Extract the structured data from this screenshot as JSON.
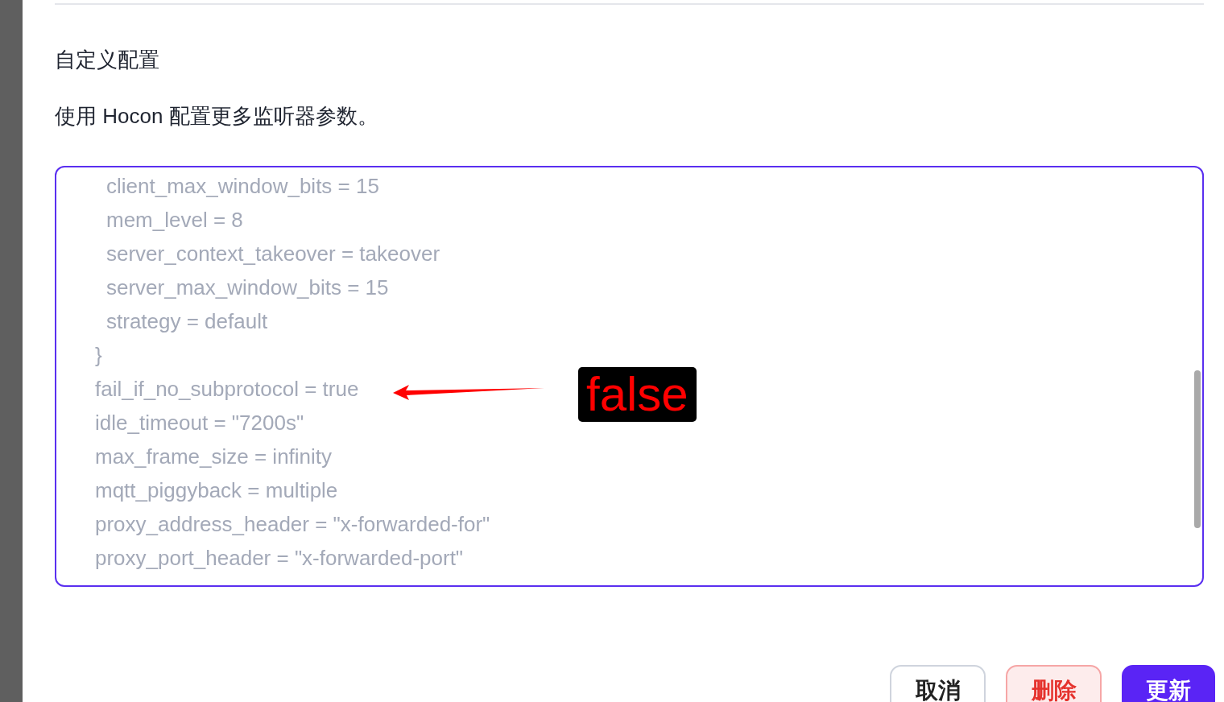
{
  "section": {
    "title": "自定义配置",
    "description": "使用 Hocon 配置更多监听器参数。"
  },
  "config_editor": {
    "lines": [
      {
        "children": [
          {
            "text": "client_max_window_bits = 15"
          },
          {
            "text": "mem_level = 8"
          },
          {
            "text": "server_context_takeover = takeover"
          },
          {
            "text": "server_max_window_bits = 15"
          },
          {
            "text": "strategy = default"
          }
        ]
      },
      {
        "text": "}"
      },
      {
        "text": "fail_if_no_subprotocol = true"
      },
      {
        "text": "idle_timeout = \"7200s\""
      },
      {
        "text": "max_frame_size = infinity"
      },
      {
        "text": "mqtt_piggyback = multiple"
      },
      {
        "text": "proxy_address_header = \"x-forwarded-for\""
      },
      {
        "text": "proxy_port_header = \"x-forwarded-port\""
      }
    ]
  },
  "annotation": {
    "label": "false"
  },
  "buttons": [
    {
      "label": "取消",
      "kind": "cancel"
    },
    {
      "label": "删除",
      "kind": "danger"
    },
    {
      "label": "更新",
      "kind": "primary"
    }
  ]
}
